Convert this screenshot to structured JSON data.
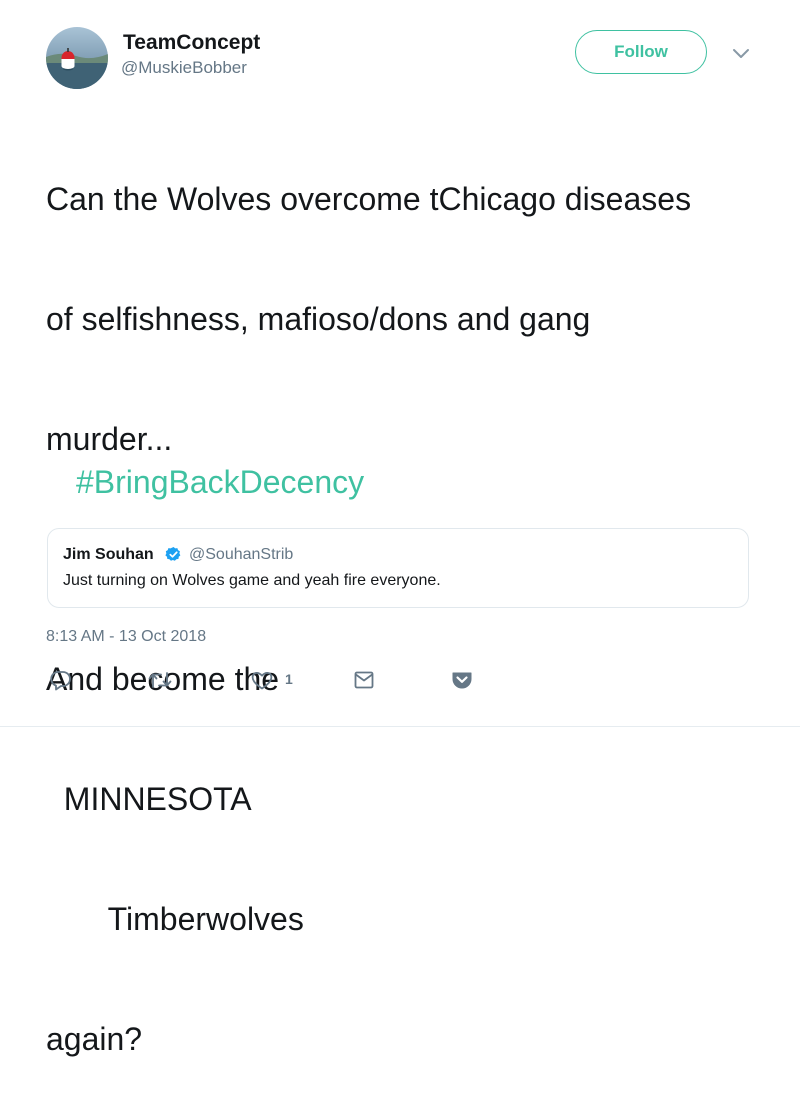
{
  "header": {
    "display_name": "TeamConcept",
    "handle": "@MuskieBobber",
    "follow_label": "Follow"
  },
  "tweet": {
    "lines": [
      "Can the Wolves overcome tChicago diseases",
      "of selfishness, mafioso/dons and gang",
      "murder...",
      "",
      "And become the",
      "  MINNESOTA",
      "       Timberwolves",
      "again?"
    ],
    "hashtag": "#BringBackDecency"
  },
  "quoted_tweet": {
    "name": "Jim Souhan",
    "handle": "@SouhanStrib",
    "text": "Just turning on Wolves game and yeah fire everyone.",
    "verified": true
  },
  "timestamp": "8:13 AM - 13 Oct 2018",
  "actions": {
    "like_count": "1"
  },
  "colors": {
    "accent": "#3fc1a1",
    "text": "#14171a",
    "secondary": "#657786",
    "verified": "#1da1f2",
    "border": "#e1e8ed"
  },
  "icons": [
    "reply-icon",
    "retweet-icon",
    "like-icon",
    "dm-icon",
    "pocket-icon",
    "chevron-down-icon",
    "verified-badge-icon"
  ]
}
